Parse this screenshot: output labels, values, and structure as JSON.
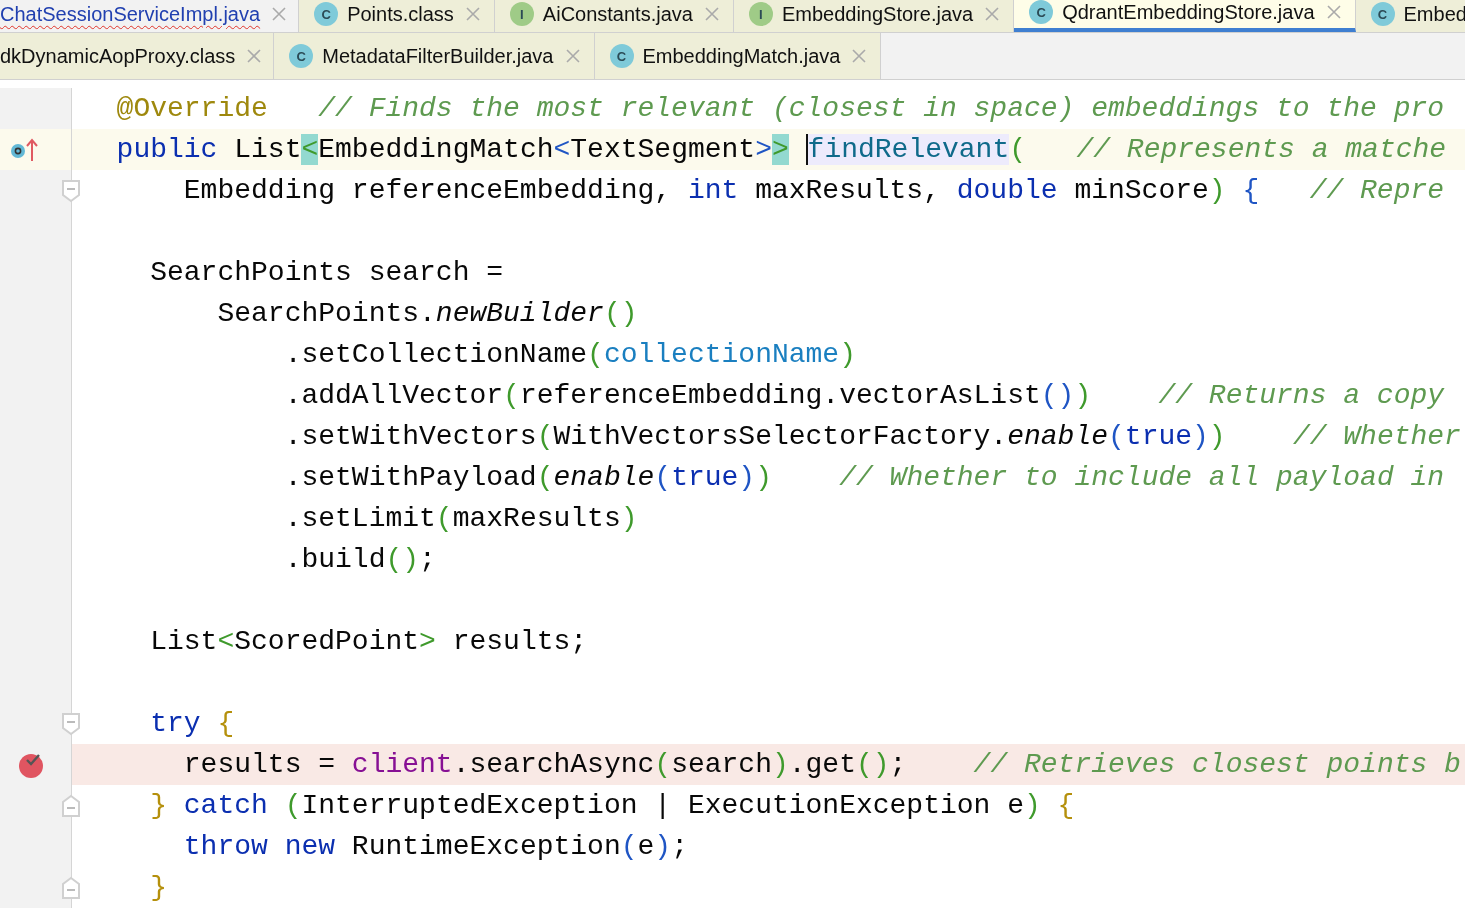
{
  "tab_rows": [
    {
      "tabs": [
        {
          "label": "ChatSessionServiceImpl.java",
          "kind": "plain",
          "selected": false,
          "error": true
        },
        {
          "label": "Points.class",
          "badge": "C",
          "kind": "class",
          "selected": false,
          "error": false
        },
        {
          "label": "AiConstants.java",
          "badge": "I",
          "kind": "interface",
          "selected": false,
          "error": false
        },
        {
          "label": "EmbeddingStore.java",
          "badge": "I",
          "kind": "interface",
          "selected": false,
          "error": false
        },
        {
          "label": "QdrantEmbeddingStore.java",
          "badge": "C",
          "kind": "class",
          "selected": true,
          "error": false
        },
        {
          "label": "Embed",
          "badge": "C",
          "kind": "class",
          "selected": false,
          "error": false
        }
      ]
    },
    {
      "tabs": [
        {
          "label": "dkDynamicAopProxy.class",
          "kind": "plain",
          "selected": false,
          "error": false
        },
        {
          "label": "MetadataFilterBuilder.java",
          "badge": "C",
          "kind": "class",
          "selected": false,
          "error": false
        },
        {
          "label": "EmbeddingMatch.java",
          "badge": "C",
          "kind": "class",
          "selected": false,
          "error": false
        }
      ]
    }
  ],
  "editor": {
    "lines": [
      {
        "current": false,
        "breakpoint": false,
        "tokens": [
          {
            "kind": "ann",
            "text": "  @Override"
          },
          {
            "kind": "cm",
            "text": "   // Finds the most relevant (closest in space) embeddings to the pro"
          }
        ]
      },
      {
        "current": true,
        "breakpoint": false,
        "gutter": {
          "kind": "override"
        },
        "tokens": [
          {
            "kind": "kw",
            "text": "  public"
          },
          {
            "kind": "plain",
            "text": " List"
          },
          {
            "kind": "match",
            "text": "<"
          },
          {
            "kind": "plain",
            "text": "EmbeddingMatch"
          },
          {
            "kind": "p2",
            "text": "<"
          },
          {
            "kind": "plain",
            "text": "TextSegment"
          },
          {
            "kind": "p2",
            "text": ">"
          },
          {
            "kind": "match",
            "text": ">"
          },
          {
            "kind": "usage",
            "text": "findRelevant",
            "caret": true
          },
          {
            "kind": "p1",
            "text": "("
          },
          {
            "kind": "cm",
            "text": "   // Represents a matche"
          }
        ]
      },
      {
        "current": false,
        "breakpoint": false,
        "gutter": {
          "kind": "fold-start"
        },
        "tokens": [
          {
            "kind": "plain",
            "text": "      Embedding referenceEmbedding, "
          },
          {
            "kind": "kw",
            "text": "int"
          },
          {
            "kind": "plain",
            "text": " maxResults, "
          },
          {
            "kind": "kw",
            "text": "double"
          },
          {
            "kind": "plain",
            "text": " minScore"
          },
          {
            "kind": "p1",
            "text": ")"
          },
          {
            "kind": "p2",
            "text": " {"
          },
          {
            "kind": "cm",
            "text": "   // Repre"
          }
        ]
      },
      {
        "current": false,
        "breakpoint": false
      },
      {
        "current": false,
        "breakpoint": false,
        "tokens": [
          {
            "kind": "plain",
            "text": "    SearchPoints search ="
          }
        ]
      },
      {
        "current": false,
        "breakpoint": false,
        "tokens": [
          {
            "kind": "plain",
            "text": "        SearchPoints."
          },
          {
            "kind": "static",
            "text": "newBuilder"
          },
          {
            "kind": "p1",
            "text": "()"
          }
        ]
      },
      {
        "current": false,
        "breakpoint": false,
        "tokens": [
          {
            "kind": "plain",
            "text": "            .setCollectionName"
          },
          {
            "kind": "p1",
            "text": "("
          },
          {
            "kind": "field",
            "text": "collectionName"
          },
          {
            "kind": "p1",
            "text": ")"
          }
        ]
      },
      {
        "current": false,
        "breakpoint": false,
        "tokens": [
          {
            "kind": "plain",
            "text": "            .addAllVector"
          },
          {
            "kind": "p1",
            "text": "("
          },
          {
            "kind": "plain",
            "text": "referenceEmbedding.vectorAsList"
          },
          {
            "kind": "p2",
            "text": "()"
          },
          {
            "kind": "p1",
            "text": ")"
          },
          {
            "kind": "cm",
            "text": "    // Returns a copy"
          }
        ]
      },
      {
        "current": false,
        "breakpoint": false,
        "tokens": [
          {
            "kind": "plain",
            "text": "            .setWithVectors"
          },
          {
            "kind": "p1",
            "text": "("
          },
          {
            "kind": "plain",
            "text": "WithVectorsSelectorFactory."
          },
          {
            "kind": "static",
            "text": "enable"
          },
          {
            "kind": "p2",
            "text": "("
          },
          {
            "kind": "kw",
            "text": "true"
          },
          {
            "kind": "p2",
            "text": ")"
          },
          {
            "kind": "p1",
            "text": ")"
          },
          {
            "kind": "cm",
            "text": "    // Whether"
          }
        ]
      },
      {
        "current": false,
        "breakpoint": false,
        "tokens": [
          {
            "kind": "plain",
            "text": "            .setWithPayload"
          },
          {
            "kind": "p1",
            "text": "("
          },
          {
            "kind": "static",
            "text": "enable"
          },
          {
            "kind": "p2",
            "text": "("
          },
          {
            "kind": "kw",
            "text": "true"
          },
          {
            "kind": "p2",
            "text": ")"
          },
          {
            "kind": "p1",
            "text": ")"
          },
          {
            "kind": "cm",
            "text": "    // Whether to include all payload in"
          }
        ]
      },
      {
        "current": false,
        "breakpoint": false,
        "tokens": [
          {
            "kind": "plain",
            "text": "            .setLimit"
          },
          {
            "kind": "p1",
            "text": "("
          },
          {
            "kind": "plain",
            "text": "maxResults"
          },
          {
            "kind": "p1",
            "text": ")"
          }
        ]
      },
      {
        "current": false,
        "breakpoint": false,
        "tokens": [
          {
            "kind": "plain",
            "text": "            .build"
          },
          {
            "kind": "p1",
            "text": "()"
          },
          {
            "kind": "plain",
            "text": ";"
          }
        ]
      },
      {
        "current": false,
        "breakpoint": false
      },
      {
        "current": false,
        "breakpoint": false,
        "tokens": [
          {
            "kind": "plain",
            "text": "    List"
          },
          {
            "kind": "p1",
            "text": "<"
          },
          {
            "kind": "plain",
            "text": "ScoredPoint"
          },
          {
            "kind": "p1",
            "text": ">"
          },
          {
            "kind": "plain",
            "text": " results;"
          }
        ]
      },
      {
        "current": false,
        "breakpoint": false
      },
      {
        "current": false,
        "breakpoint": false,
        "gutter": {
          "kind": "fold-start"
        },
        "tokens": [
          {
            "kind": "kw",
            "text": "    try"
          },
          {
            "kind": "brace",
            "text": " {"
          }
        ]
      },
      {
        "current": false,
        "breakpoint": true,
        "gutter": {
          "kind": "breakpoint"
        },
        "tokens": [
          {
            "kind": "plain",
            "text": "      results = "
          },
          {
            "kind": "inst",
            "text": "client"
          },
          {
            "kind": "plain",
            "text": ".searchAsync"
          },
          {
            "kind": "p1",
            "text": "("
          },
          {
            "kind": "plain",
            "text": "search"
          },
          {
            "kind": "p1",
            "text": ")"
          },
          {
            "kind": "plain",
            "text": ".get"
          },
          {
            "kind": "p1",
            "text": "()"
          },
          {
            "kind": "plain",
            "text": ";"
          },
          {
            "kind": "cm",
            "text": "    // Retrieves closest points b"
          }
        ]
      },
      {
        "current": false,
        "breakpoint": false,
        "gutter": {
          "kind": "fold-end"
        },
        "tokens": [
          {
            "kind": "brace",
            "text": "    }"
          },
          {
            "kind": "kw",
            "text": " catch"
          },
          {
            "kind": "p1",
            "text": " ("
          },
          {
            "kind": "plain",
            "text": "InterruptedException | ExecutionException e"
          },
          {
            "kind": "p1",
            "text": ")"
          },
          {
            "kind": "brace",
            "text": " {"
          }
        ]
      },
      {
        "current": false,
        "breakpoint": false,
        "tokens": [
          {
            "kind": "kw",
            "text": "      throw new"
          },
          {
            "kind": "plain",
            "text": " RuntimeException"
          },
          {
            "kind": "p2",
            "text": "("
          },
          {
            "kind": "plain",
            "text": "e"
          },
          {
            "kind": "p2",
            "text": ")"
          },
          {
            "kind": "plain",
            "text": ";"
          }
        ]
      },
      {
        "current": false,
        "breakpoint": false,
        "gutter": {
          "kind": "fold-end"
        },
        "tokens": [
          {
            "kind": "brace",
            "text": "    }"
          }
        ]
      }
    ]
  }
}
